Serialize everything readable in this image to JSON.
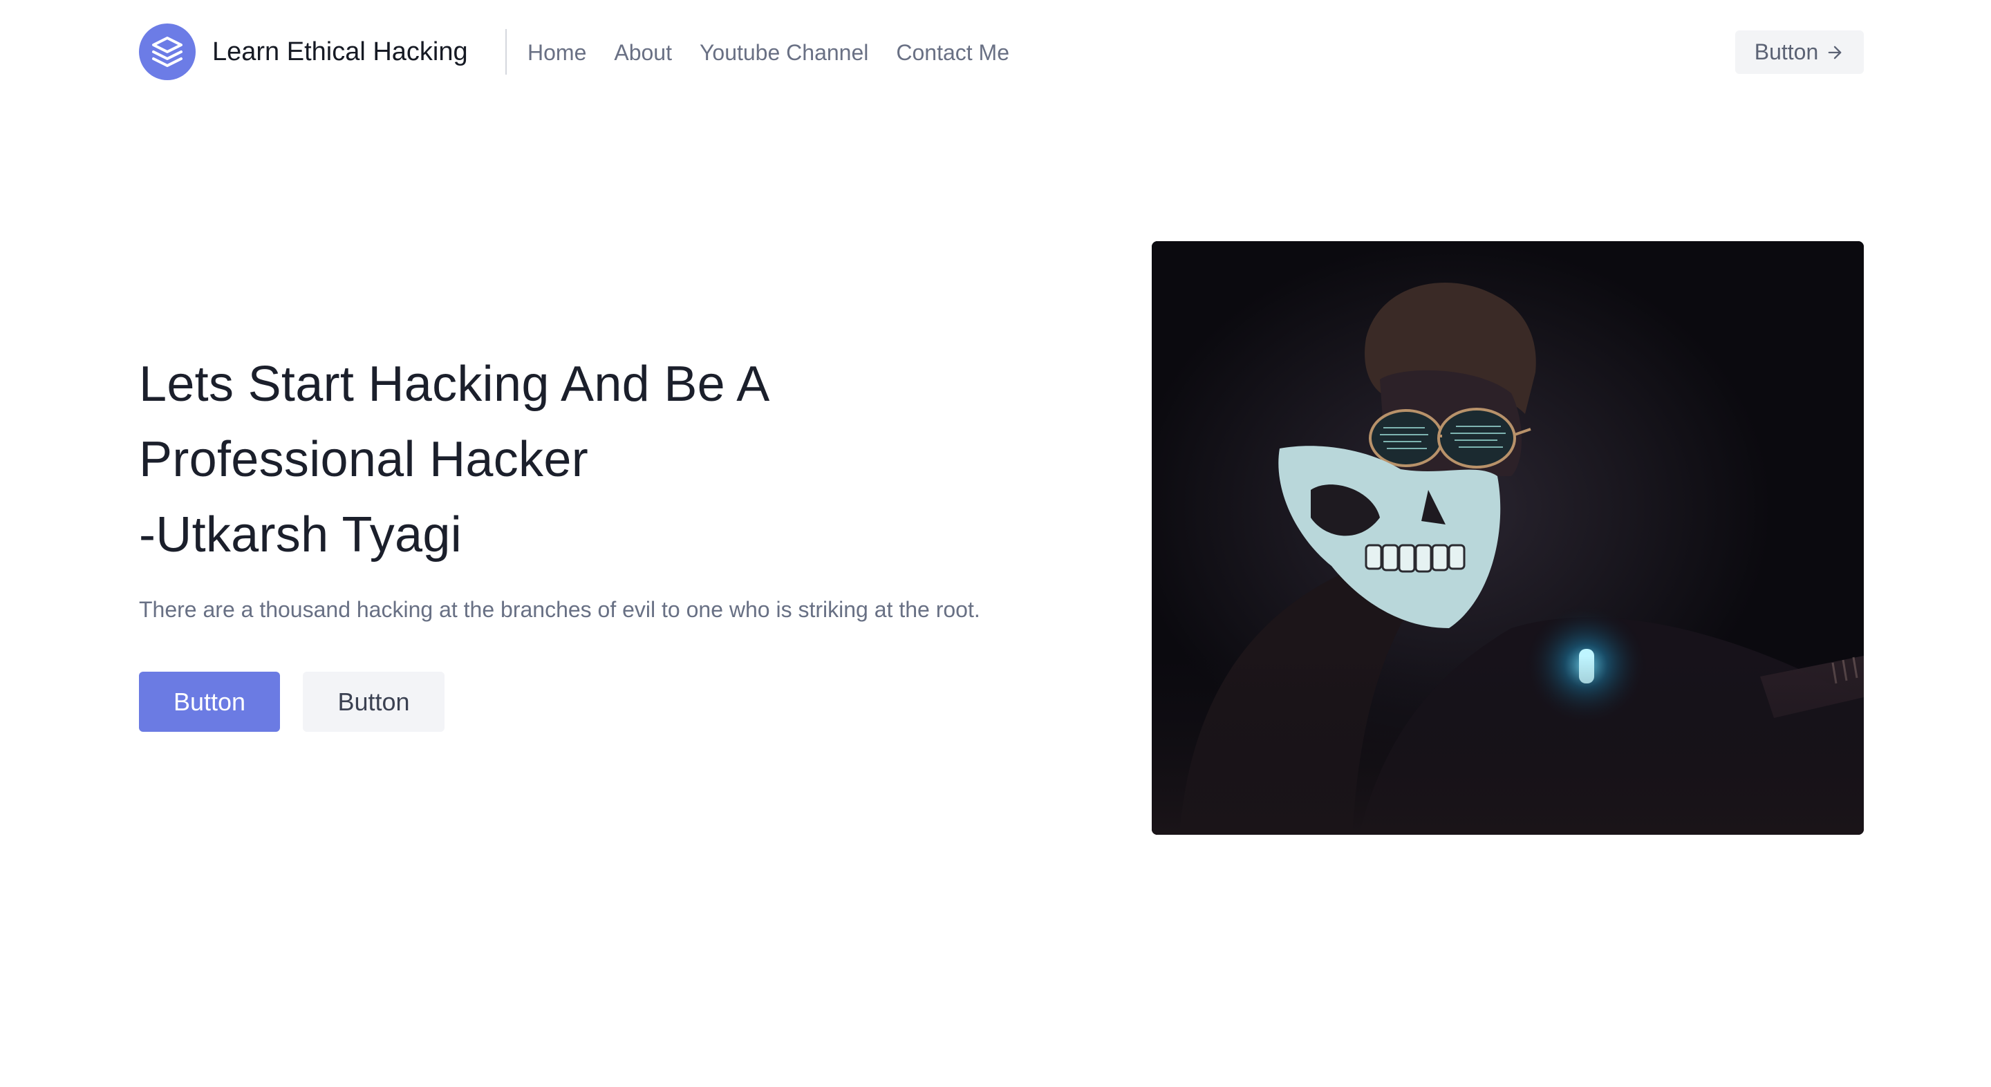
{
  "header": {
    "brand_title": "Learn Ethical Hacking",
    "logo_icon": "stack-layers-icon",
    "nav": [
      {
        "label": "Home"
      },
      {
        "label": "About"
      },
      {
        "label": "Youtube Channel"
      },
      {
        "label": "Contact Me"
      }
    ],
    "cta_label": "Button",
    "cta_icon": "arrow-right-icon"
  },
  "hero": {
    "heading_lines": [
      "Lets Start Hacking And Be A",
      "Professional Hacker",
      "-Utkarsh Tyagi"
    ],
    "tagline": "There are a thousand hacking at the branches of evil to one who is striking at the root.",
    "primary_button": "Button",
    "secondary_button": "Button",
    "image_subject": "hacker-in-skull-mask-photo"
  },
  "colors": {
    "accent": "#6b7be3",
    "heading": "#1b1f2b",
    "muted_text": "#687084",
    "button_light_bg": "#f3f4f7"
  }
}
